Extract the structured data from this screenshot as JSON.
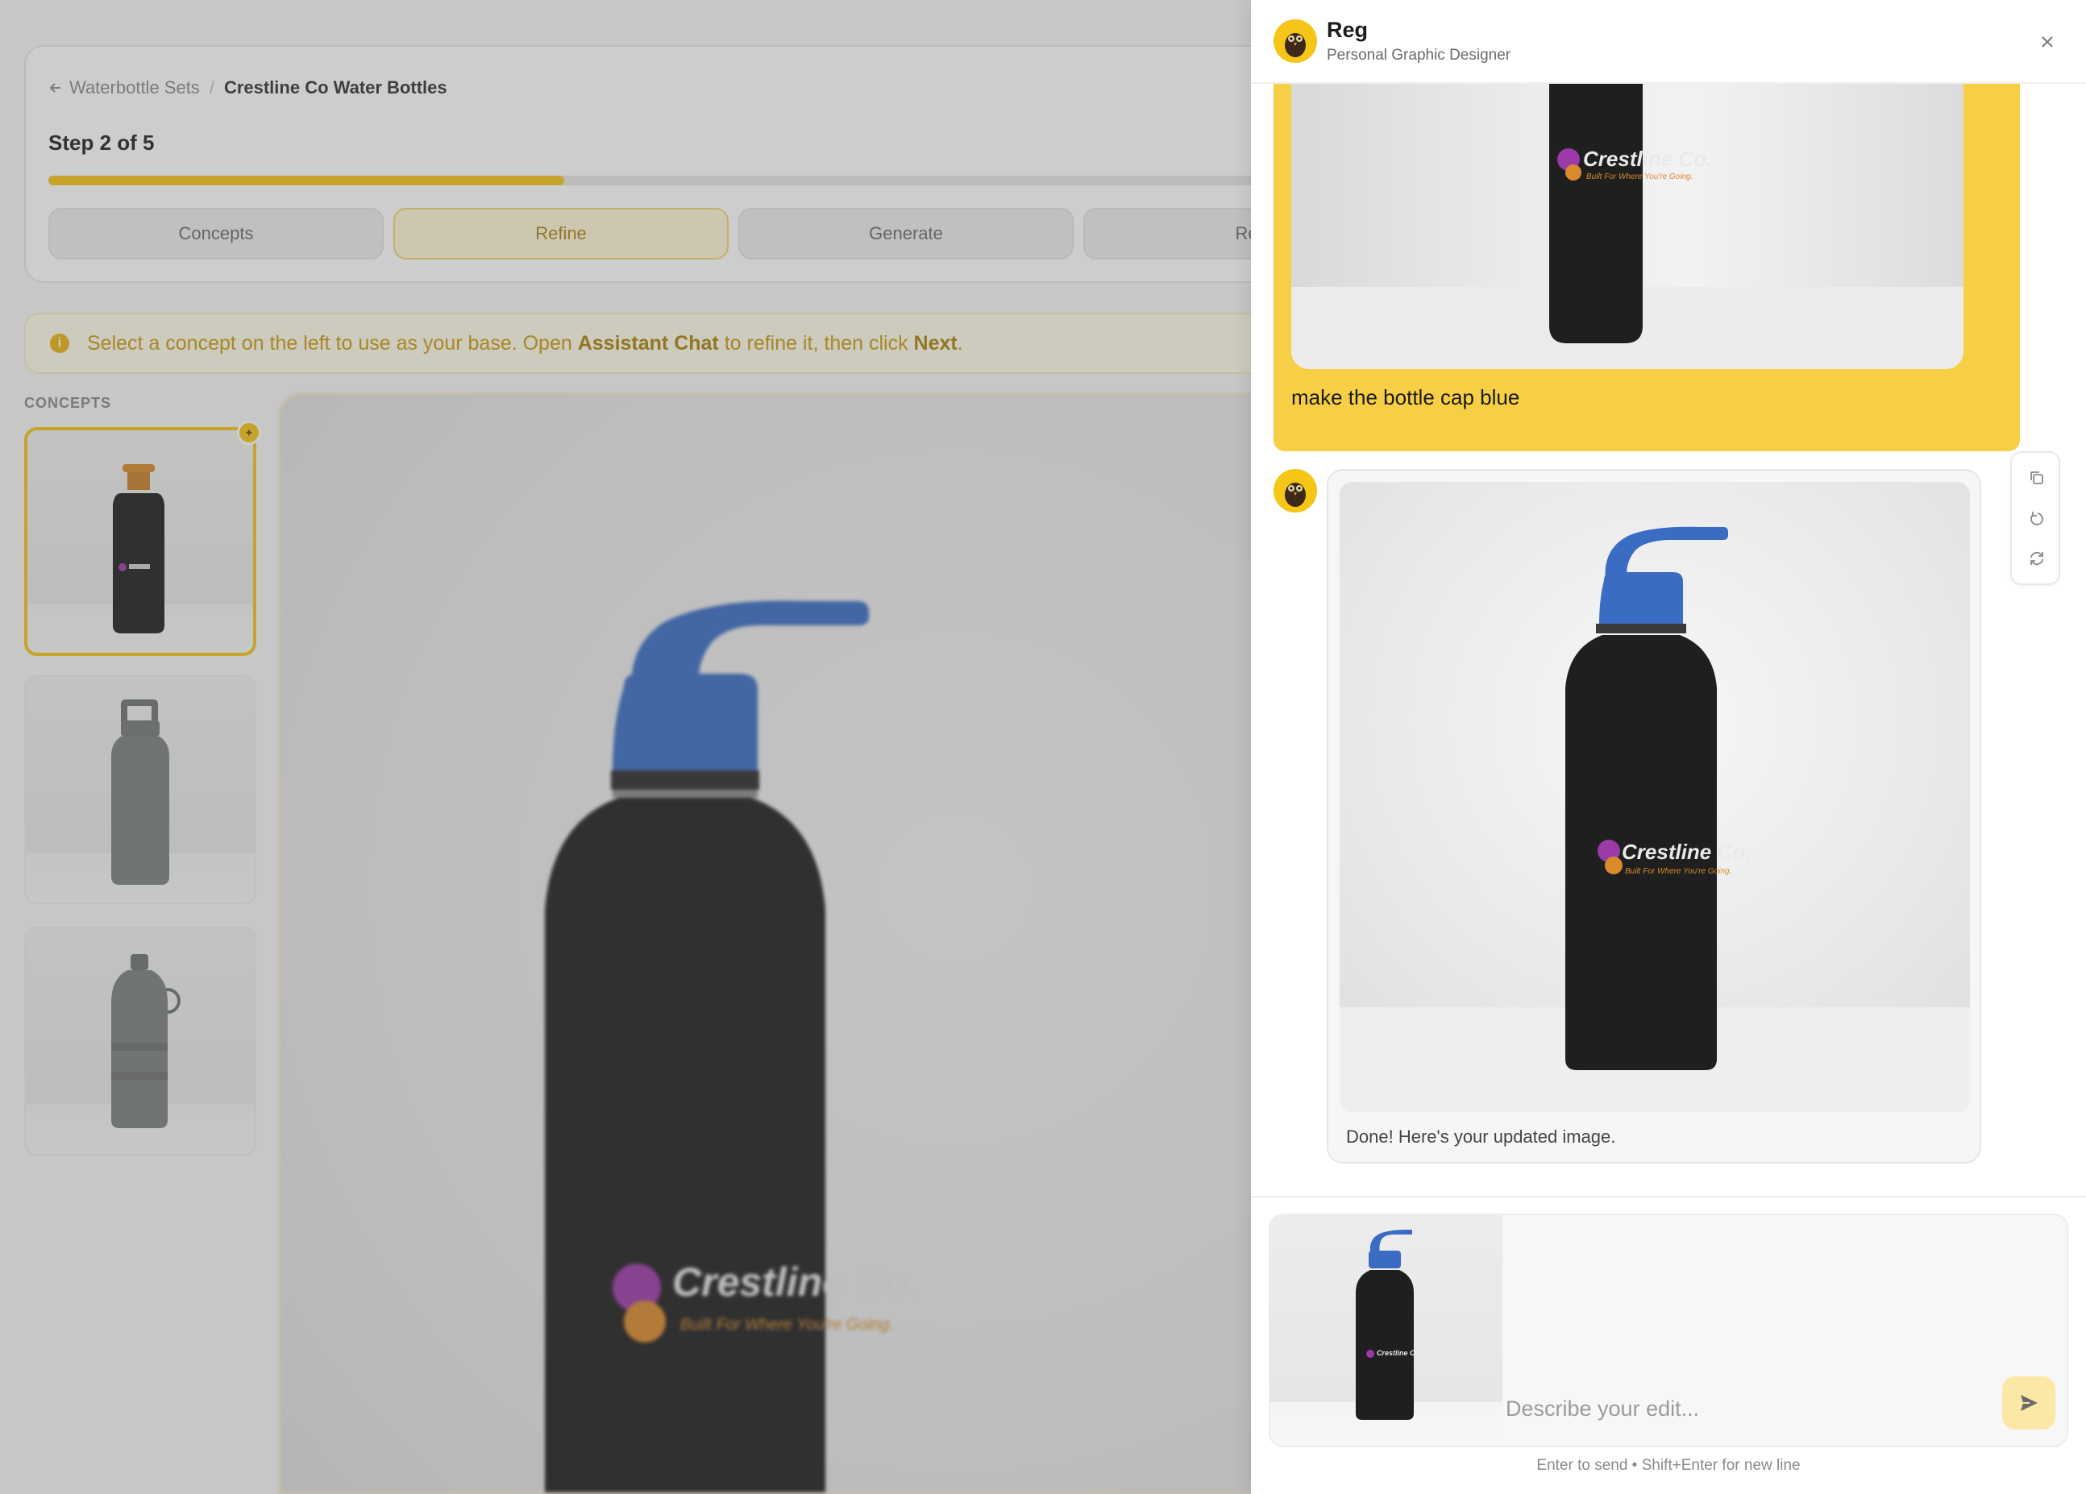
{
  "app": {
    "breadcrumb": {
      "back_label": "Waterbottle Sets",
      "current": "Crestline Co Water Bottles"
    },
    "step_label": "Step 2 of 5",
    "progress_fraction": 0.4,
    "steps": [
      {
        "label": "Concepts",
        "active": false
      },
      {
        "label": "Refine",
        "active": true
      },
      {
        "label": "Generate",
        "active": false
      },
      {
        "label": "Rev",
        "active": false
      }
    ],
    "info": {
      "prefix": "Select a concept on the left to use as your base. Open ",
      "highlight1": "Assistant Chat",
      "middle": " to refine it, then click ",
      "highlight2": "Next",
      "suffix": "."
    },
    "concepts_heading": "CONCEPTS"
  },
  "brand": {
    "logo_name": "Crestline Co.",
    "logo_tagline": "Built For Where You're Going."
  },
  "panel": {
    "assistant_name": "Reg",
    "assistant_role": "Personal Graphic Designer",
    "user_message": "make the bottle cap blue",
    "assistant_message": "Done! Here's your updated image.",
    "composer_placeholder": "Describe your edit...",
    "hint": "Enter to send • Shift+Enter for new line"
  },
  "colors": {
    "accent": "#f5c518",
    "user_bubble": "#f7cf45",
    "cap_blue": "#3a6cc4",
    "cap_orange": "#d98a2b",
    "bottle_black": "#1f1f1f",
    "bottle_gray": "#7c817d"
  },
  "icons": {
    "back": "arrow-left-icon",
    "info": "info-icon",
    "close": "close-icon",
    "copy": "copy-icon",
    "undo": "undo-icon",
    "regenerate": "refresh-icon",
    "send": "send-icon",
    "star": "star-icon"
  }
}
